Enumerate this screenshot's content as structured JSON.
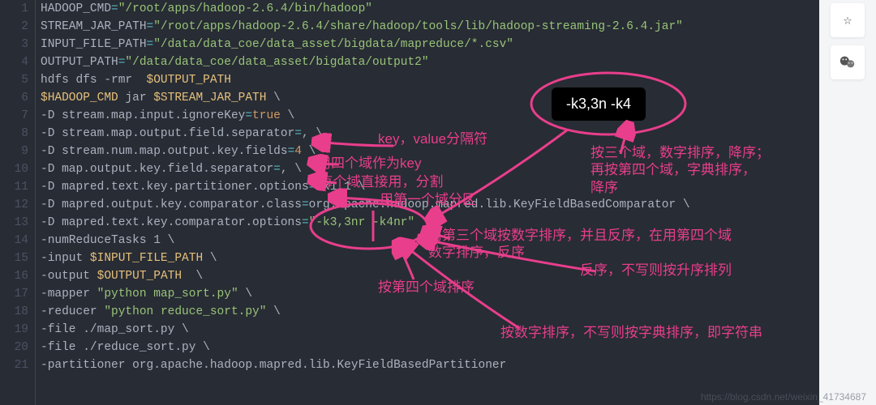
{
  "tooltip": "-k3,3n -k4",
  "code": {
    "lines": [
      {
        "n": 1,
        "seg": [
          [
            "p",
            "HADOOP_CMD"
          ],
          [
            "c",
            "="
          ],
          [
            "g",
            "\"/root/apps/hadoop-2.6.4/bin/hadoop\""
          ]
        ]
      },
      {
        "n": 2,
        "seg": [
          [
            "p",
            "STREAM_JAR_PATH"
          ],
          [
            "c",
            "="
          ],
          [
            "g",
            "\"/root/apps/hadoop-2.6.4/share/hadoop/tools/lib/hadoop-streaming-2.6.4.jar\""
          ]
        ]
      },
      {
        "n": 3,
        "seg": [
          [
            "p",
            "INPUT_FILE_PATH"
          ],
          [
            "c",
            "="
          ],
          [
            "g",
            "\"/data/data_coe/data_asset/bigdata/mapreduce/*.csv\""
          ]
        ]
      },
      {
        "n": 4,
        "seg": [
          [
            "p",
            "OUTPUT_PATH"
          ],
          [
            "c",
            "="
          ],
          [
            "g",
            "\"/data/data_coe/data_asset/bigdata/output2\""
          ]
        ]
      },
      {
        "n": 5,
        "seg": [
          [
            "p",
            "hdfs dfs -rmr  "
          ],
          [
            "y",
            "$OUTPUT_PATH"
          ]
        ]
      },
      {
        "n": 6,
        "seg": [
          [
            "y",
            "$HADOOP_CMD"
          ],
          [
            "p",
            " jar "
          ],
          [
            "y",
            "$STREAM_JAR_PATH"
          ],
          [
            "p",
            " \\"
          ]
        ]
      },
      {
        "n": 7,
        "seg": [
          [
            "p",
            "-D stream.map.input.ignoreKey"
          ],
          [
            "c",
            "="
          ],
          [
            "o",
            "true"
          ],
          [
            "p",
            " \\"
          ]
        ]
      },
      {
        "n": 8,
        "seg": [
          [
            "p",
            "-D stream.map.output.field.separator"
          ],
          [
            "c",
            "="
          ],
          [
            "p",
            ", \\"
          ]
        ]
      },
      {
        "n": 9,
        "seg": [
          [
            "p",
            "-D stream.num.map.output.key.fields"
          ],
          [
            "c",
            "="
          ],
          [
            "o",
            "4"
          ],
          [
            "p",
            " \\"
          ]
        ]
      },
      {
        "n": 10,
        "seg": [
          [
            "p",
            "-D map.output.key.field.separator"
          ],
          [
            "c",
            "="
          ],
          [
            "p",
            ", \\"
          ]
        ]
      },
      {
        "n": 11,
        "seg": [
          [
            "p",
            "-D mapred.text.key.partitioner.options"
          ],
          [
            "c",
            "="
          ],
          [
            "p",
            "-k1,1 \\"
          ]
        ]
      },
      {
        "n": 12,
        "seg": [
          [
            "p",
            "-D mapred.output.key.comparator.class"
          ],
          [
            "c",
            "="
          ],
          [
            "p",
            "org.apache.hadoop.mapred.lib.KeyFieldBasedComparator \\"
          ]
        ]
      },
      {
        "n": 13,
        "seg": [
          [
            "p",
            "-D mapred.text.key.comparator.options"
          ],
          [
            "c",
            "="
          ],
          [
            "g",
            "\"-k3,3nr -k4nr\""
          ],
          [
            "p",
            " \\"
          ]
        ]
      },
      {
        "n": 14,
        "seg": [
          [
            "p",
            "-numReduceTasks 1 \\"
          ]
        ]
      },
      {
        "n": 15,
        "seg": [
          [
            "p",
            "-input "
          ],
          [
            "y",
            "$INPUT_FILE_PATH"
          ],
          [
            "p",
            " \\"
          ]
        ]
      },
      {
        "n": 16,
        "seg": [
          [
            "p",
            "-output "
          ],
          [
            "y",
            "$OUTPUT_PATH"
          ],
          [
            "p",
            "  \\"
          ]
        ]
      },
      {
        "n": 17,
        "seg": [
          [
            "p",
            "-mapper "
          ],
          [
            "g",
            "\"python map_sort.py\""
          ],
          [
            "p",
            " \\"
          ]
        ]
      },
      {
        "n": 18,
        "seg": [
          [
            "p",
            "-reducer "
          ],
          [
            "g",
            "\"python reduce_sort.py\""
          ],
          [
            "p",
            " \\"
          ]
        ]
      },
      {
        "n": 19,
        "seg": [
          [
            "p",
            "-file ./map_sort.py \\"
          ]
        ]
      },
      {
        "n": 20,
        "seg": [
          [
            "p",
            "-file ./reduce_sort.py \\"
          ]
        ]
      },
      {
        "n": 21,
        "seg": [
          [
            "p",
            "-partitioner org.apache.hadoop.mapred.lib.KeyFieldBasedPartitioner"
          ]
        ]
      }
    ]
  },
  "annotations": {
    "a1": "key，value分隔符",
    "a2": "用四个域作为key",
    "a3": "k每个域直接用，分割",
    "a4": "用第一个域分区",
    "a5": "按三个域，数字排序，降序；\n再按第四个域，字典排序，\n降序",
    "a6": "用第三个域按数字排序，并且反序，在用第四个域\n数字排序，反序",
    "a7": "按第四个域排序",
    "a8": "反序，不写则按升序排列",
    "a9": "按数字排序，不写则按字典排序，即字符串"
  },
  "side_icons": {
    "i1": "star-icon",
    "i2": "wechat-icon"
  },
  "watermark": "https://blog.csdn.net/weixin_41734687"
}
